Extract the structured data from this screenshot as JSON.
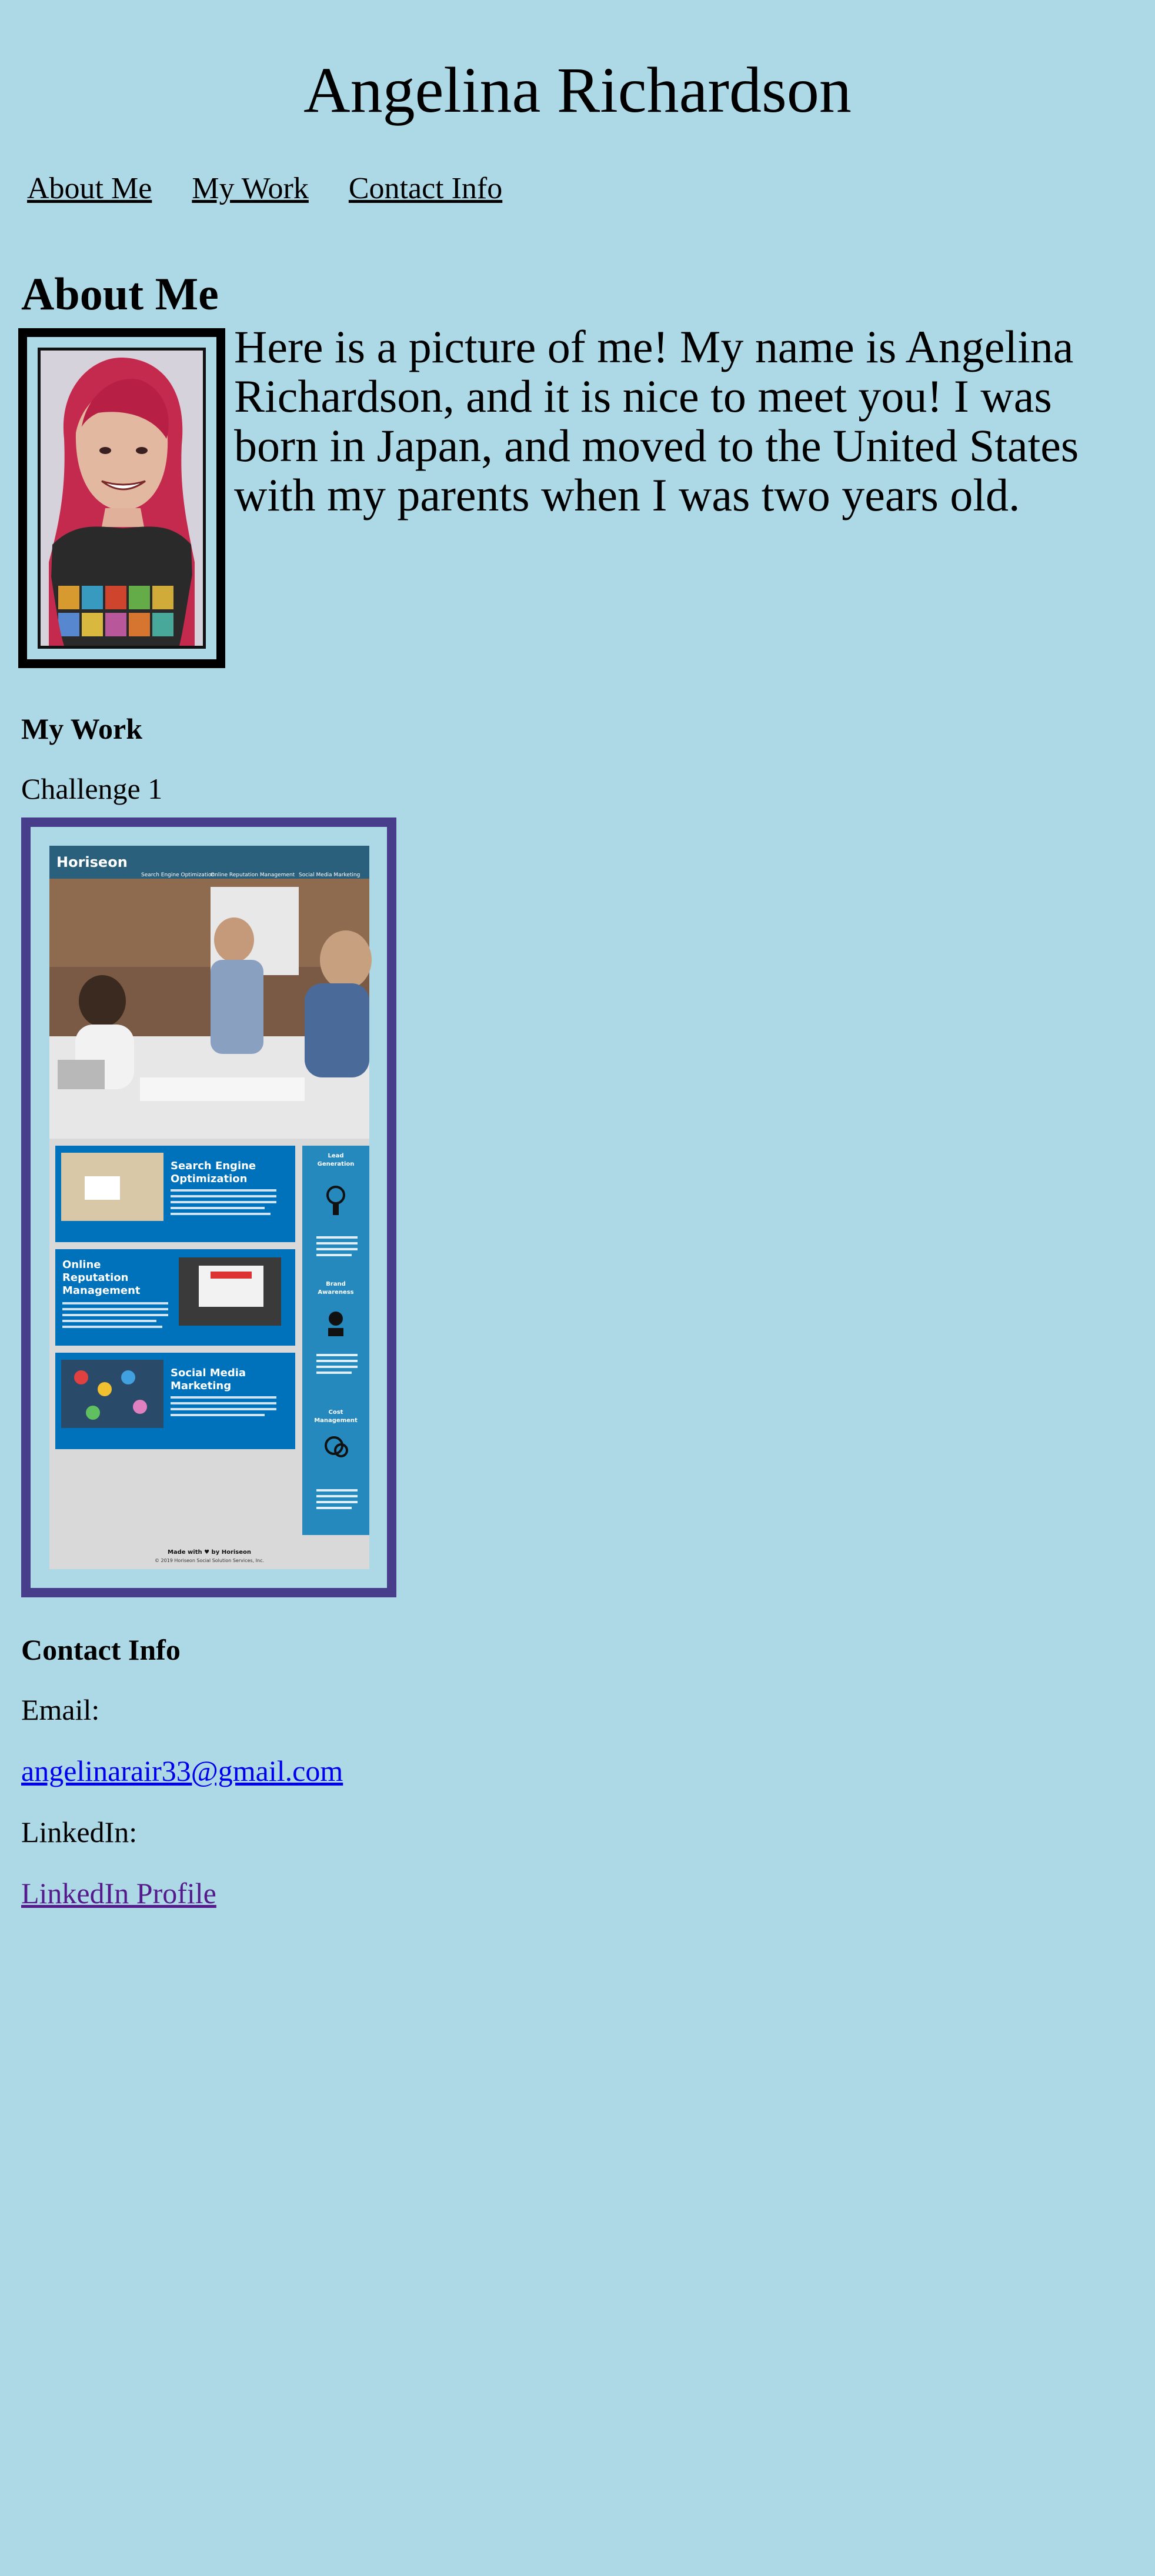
{
  "header": {
    "title": "Angelina Richardson"
  },
  "nav": {
    "items": [
      "About Me",
      "My Work",
      "Contact Info"
    ]
  },
  "about": {
    "heading": "About Me",
    "text": "Here is a picture of me! My name is Angelina Richardson, and it is nice to meet you! I was born in Japan, and moved to the United States with my parents when I was two years old."
  },
  "work": {
    "heading": "My Work",
    "project_title": "Challenge 1",
    "screenshot": {
      "brand": "Horiseon",
      "nav": [
        "Search Engine Optimization",
        "Online Reputation Management",
        "Social Media Marketing"
      ],
      "cards": [
        {
          "title": "Search Engine Optimization",
          "body": "The dominance of mobile internet use means that users are searching for the right business as they travel, shop, or sit on their couch at home. Search Engine Optimization (SEO) allows you to increase your visibility and find the right customers for your business."
        },
        {
          "title": "Online Reputation Management",
          "body": "The web is full of opinions and some of those can be negative. Social media allows anyone with an internet connection to say whatever they want about your business. Online Reputation Management gives you the control over what potential customers see when they search for your business."
        },
        {
          "title": "Social Media Marketing",
          "body": "Social media continues to have a sizable influence on buying habits. Social media marketing helps you determine which platforms are suited to your brand, using analytics to find the right markets and increase your lead generation."
        }
      ],
      "benefits": [
        {
          "title": "Lead Generation",
          "body": "Inbound strategies for lead generation require less work for your business, bringing customers directly to your website."
        },
        {
          "title": "Brand Awareness",
          "body": "Users find your business through paid and organic searches, increasing the search ranking and visibility for your business."
        },
        {
          "title": "Cost Management",
          "body": "As the search ranking for your business increases, your advertising costs decrease, and you no longer need to advertise your page."
        }
      ],
      "footer_made": "Made with ♥ by Horiseon",
      "footer_copy": "© 2019 Horiseon Social Solution Services, Inc."
    }
  },
  "contact": {
    "heading": "Contact Info",
    "email_label": "Email:",
    "email": "angelinarair33@gmail.com",
    "linkedin_label": "LinkedIn:",
    "linkedin_text": "LinkedIn Profile"
  },
  "colors": {
    "background": "#add8e6",
    "work_border": "#483d8b",
    "link_visited": "#551a8b",
    "link": "#0000ee"
  }
}
